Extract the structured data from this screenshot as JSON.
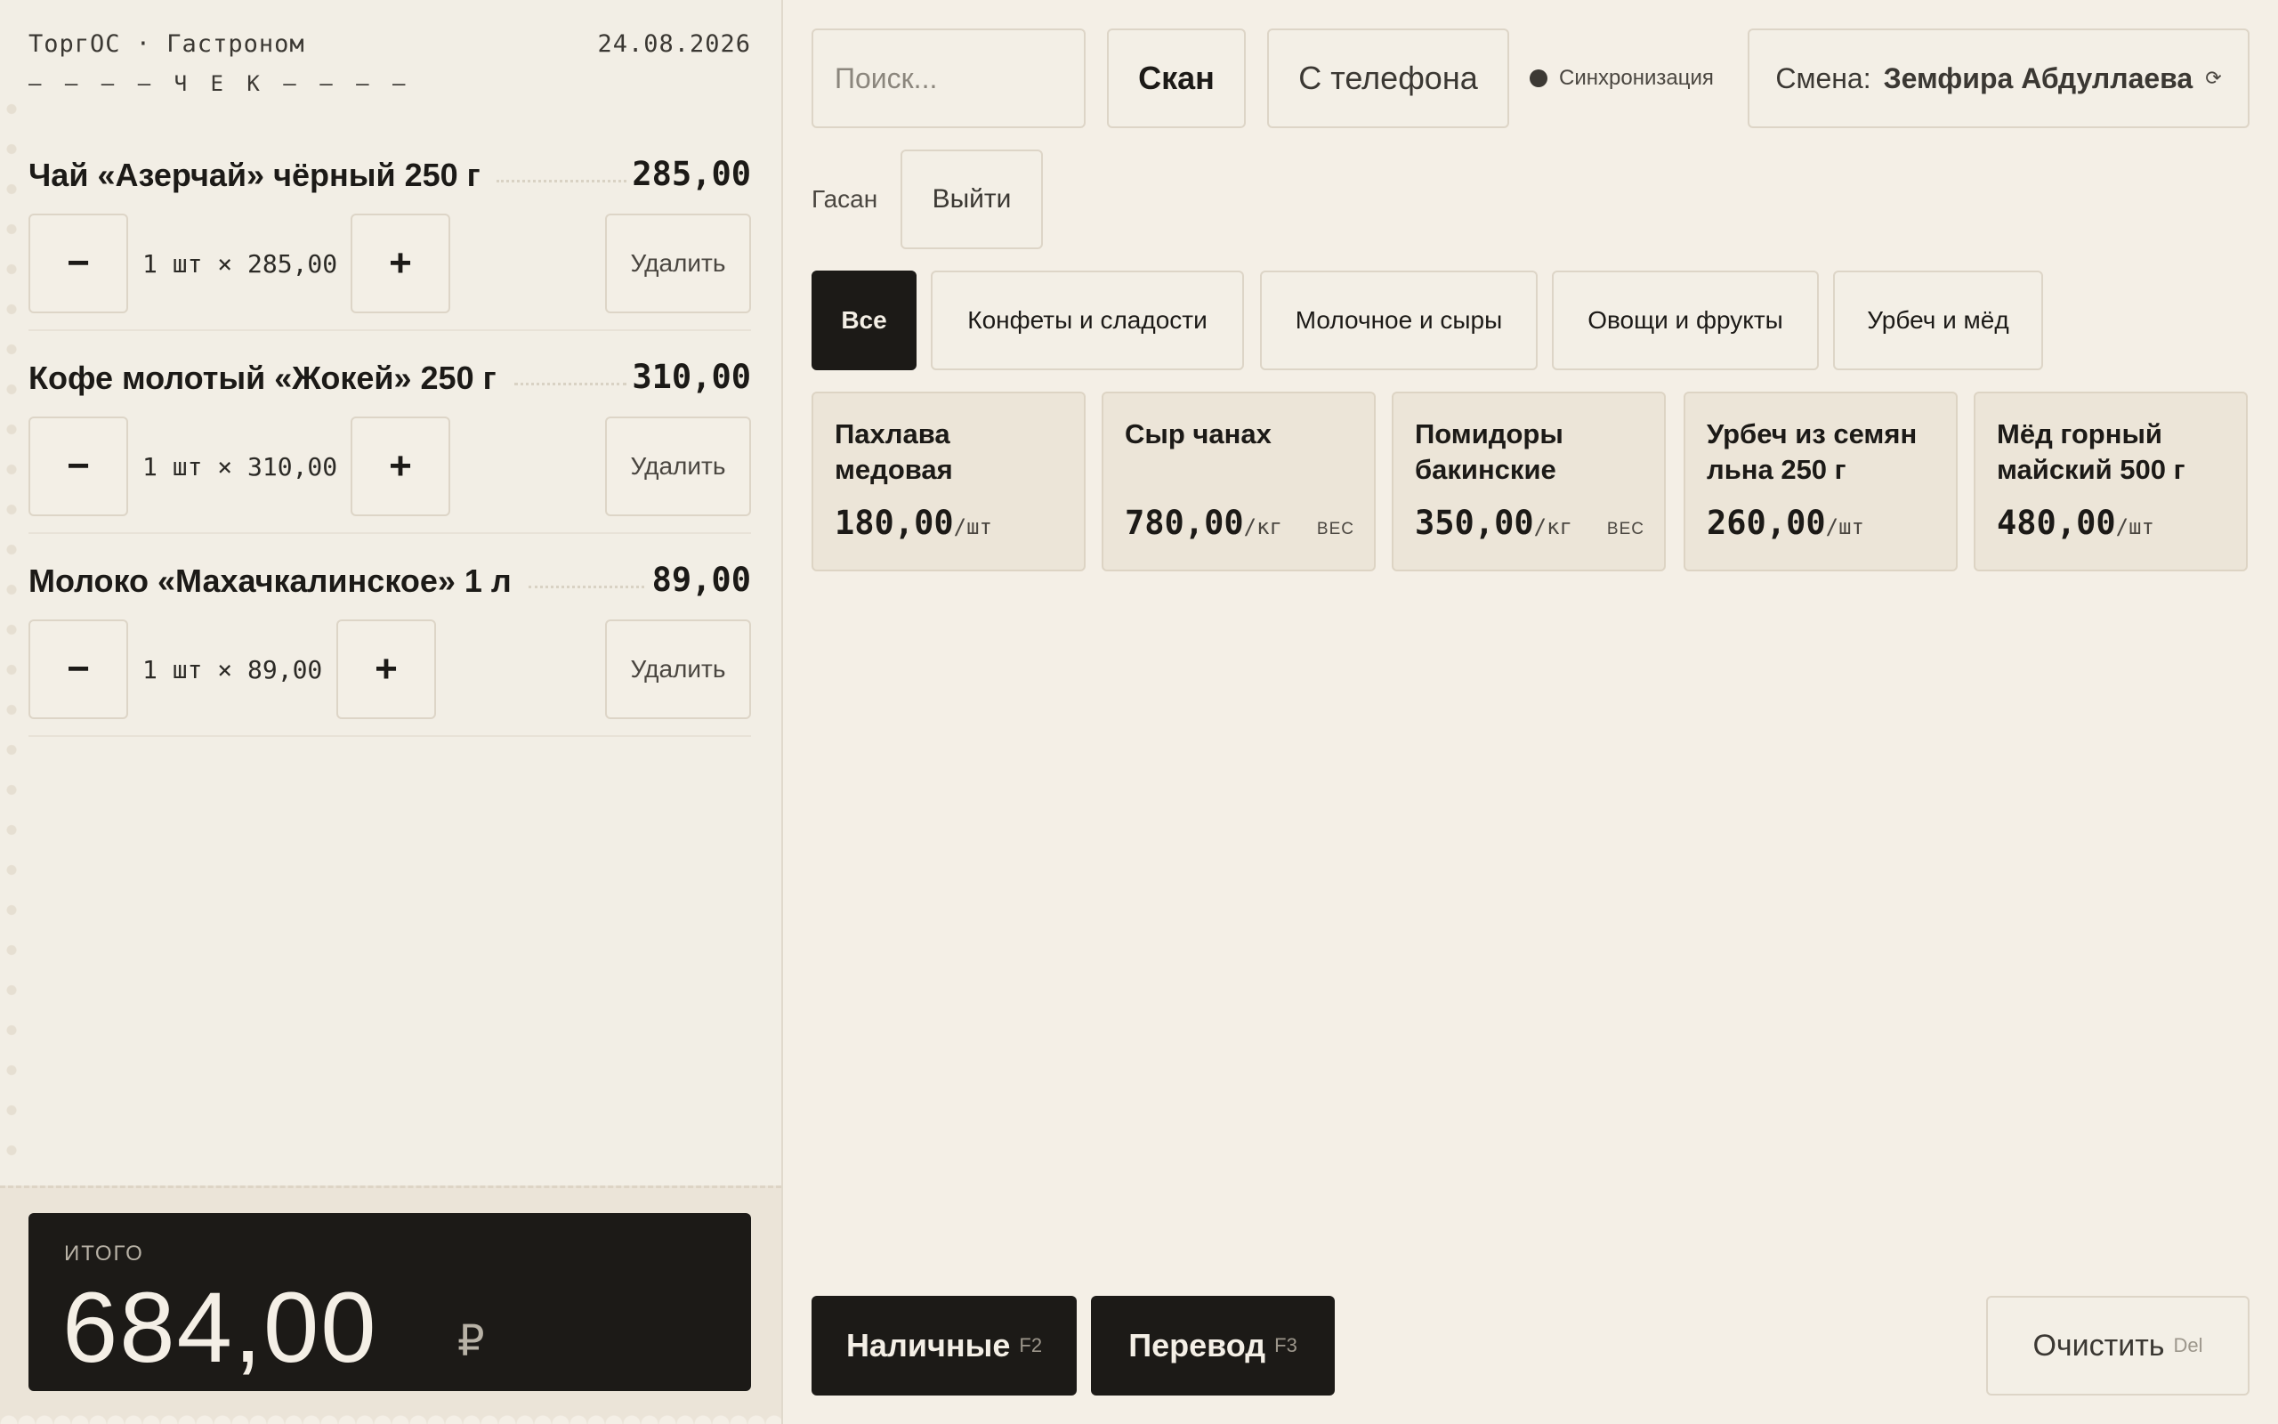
{
  "receipt": {
    "store": "ТоргОС · Гастроном",
    "date": "24.08.2026",
    "title": "— — — — Ч Е К — — — —",
    "items": [
      {
        "name": "Чай «Азерчай» чёрный 250 г",
        "price": "285,00",
        "qty_text": "1 шт × 285,00",
        "minus": "−",
        "plus": "+",
        "delete_label": "Удалить"
      },
      {
        "name": "Кофе молотый «Жокей» 250 г",
        "price": "310,00",
        "qty_text": "1 шт × 310,00",
        "minus": "−",
        "plus": "+",
        "delete_label": "Удалить"
      },
      {
        "name": "Молоко «Махачкалинское» 1 л",
        "price": "89,00",
        "qty_text": "1 шт × 89,00",
        "minus": "−",
        "plus": "+",
        "delete_label": "Удалить"
      }
    ],
    "total_label": "ИТОГО",
    "total_value": "684,00",
    "currency": "₽"
  },
  "toolbar": {
    "search_placeholder": "Поиск...",
    "scan_label": "Скан",
    "phone_label": "С телефона",
    "sync_label": "Синхронизация",
    "shift_label": "Смена:",
    "shift_user": "Земфира Абдуллаева",
    "shift_icon": "refresh-icon",
    "shift_icon_glyph": "⟳",
    "user_label": "Гасан",
    "logout_label": "Выйти"
  },
  "categories": [
    {
      "label": "Все",
      "active": true
    },
    {
      "label": "Конфеты и сладости",
      "active": false
    },
    {
      "label": "Молочное и сыры",
      "active": false
    },
    {
      "label": "Овощи и фрукты",
      "active": false
    },
    {
      "label": "Урбеч и мёд",
      "active": false
    }
  ],
  "products": [
    {
      "name": "Пахлава медовая",
      "price": "180,00",
      "unit": "/шт",
      "weight_tag": ""
    },
    {
      "name": "Сыр чанах",
      "price": "780,00",
      "unit": "/кг",
      "weight_tag": "ВЕС"
    },
    {
      "name": "Помидоры бакинские",
      "price": "350,00",
      "unit": "/кг",
      "weight_tag": "ВЕС"
    },
    {
      "name": "Урбеч из семян льна 250 г",
      "price": "260,00",
      "unit": "/шт",
      "weight_tag": ""
    },
    {
      "name": "Мёд горный майский 500 г",
      "price": "480,00",
      "unit": "/шт",
      "weight_tag": ""
    }
  ],
  "actions": {
    "cash_label": "Наличные",
    "cash_key": "F2",
    "transfer_label": "Перевод",
    "transfer_key": "F3",
    "clear_label": "Очистить",
    "clear_key": "Del"
  },
  "colors": {
    "background": "#f4efe6",
    "dark": "#1c1a17",
    "card": "#ece5d8",
    "border": "#ddd5c7"
  }
}
